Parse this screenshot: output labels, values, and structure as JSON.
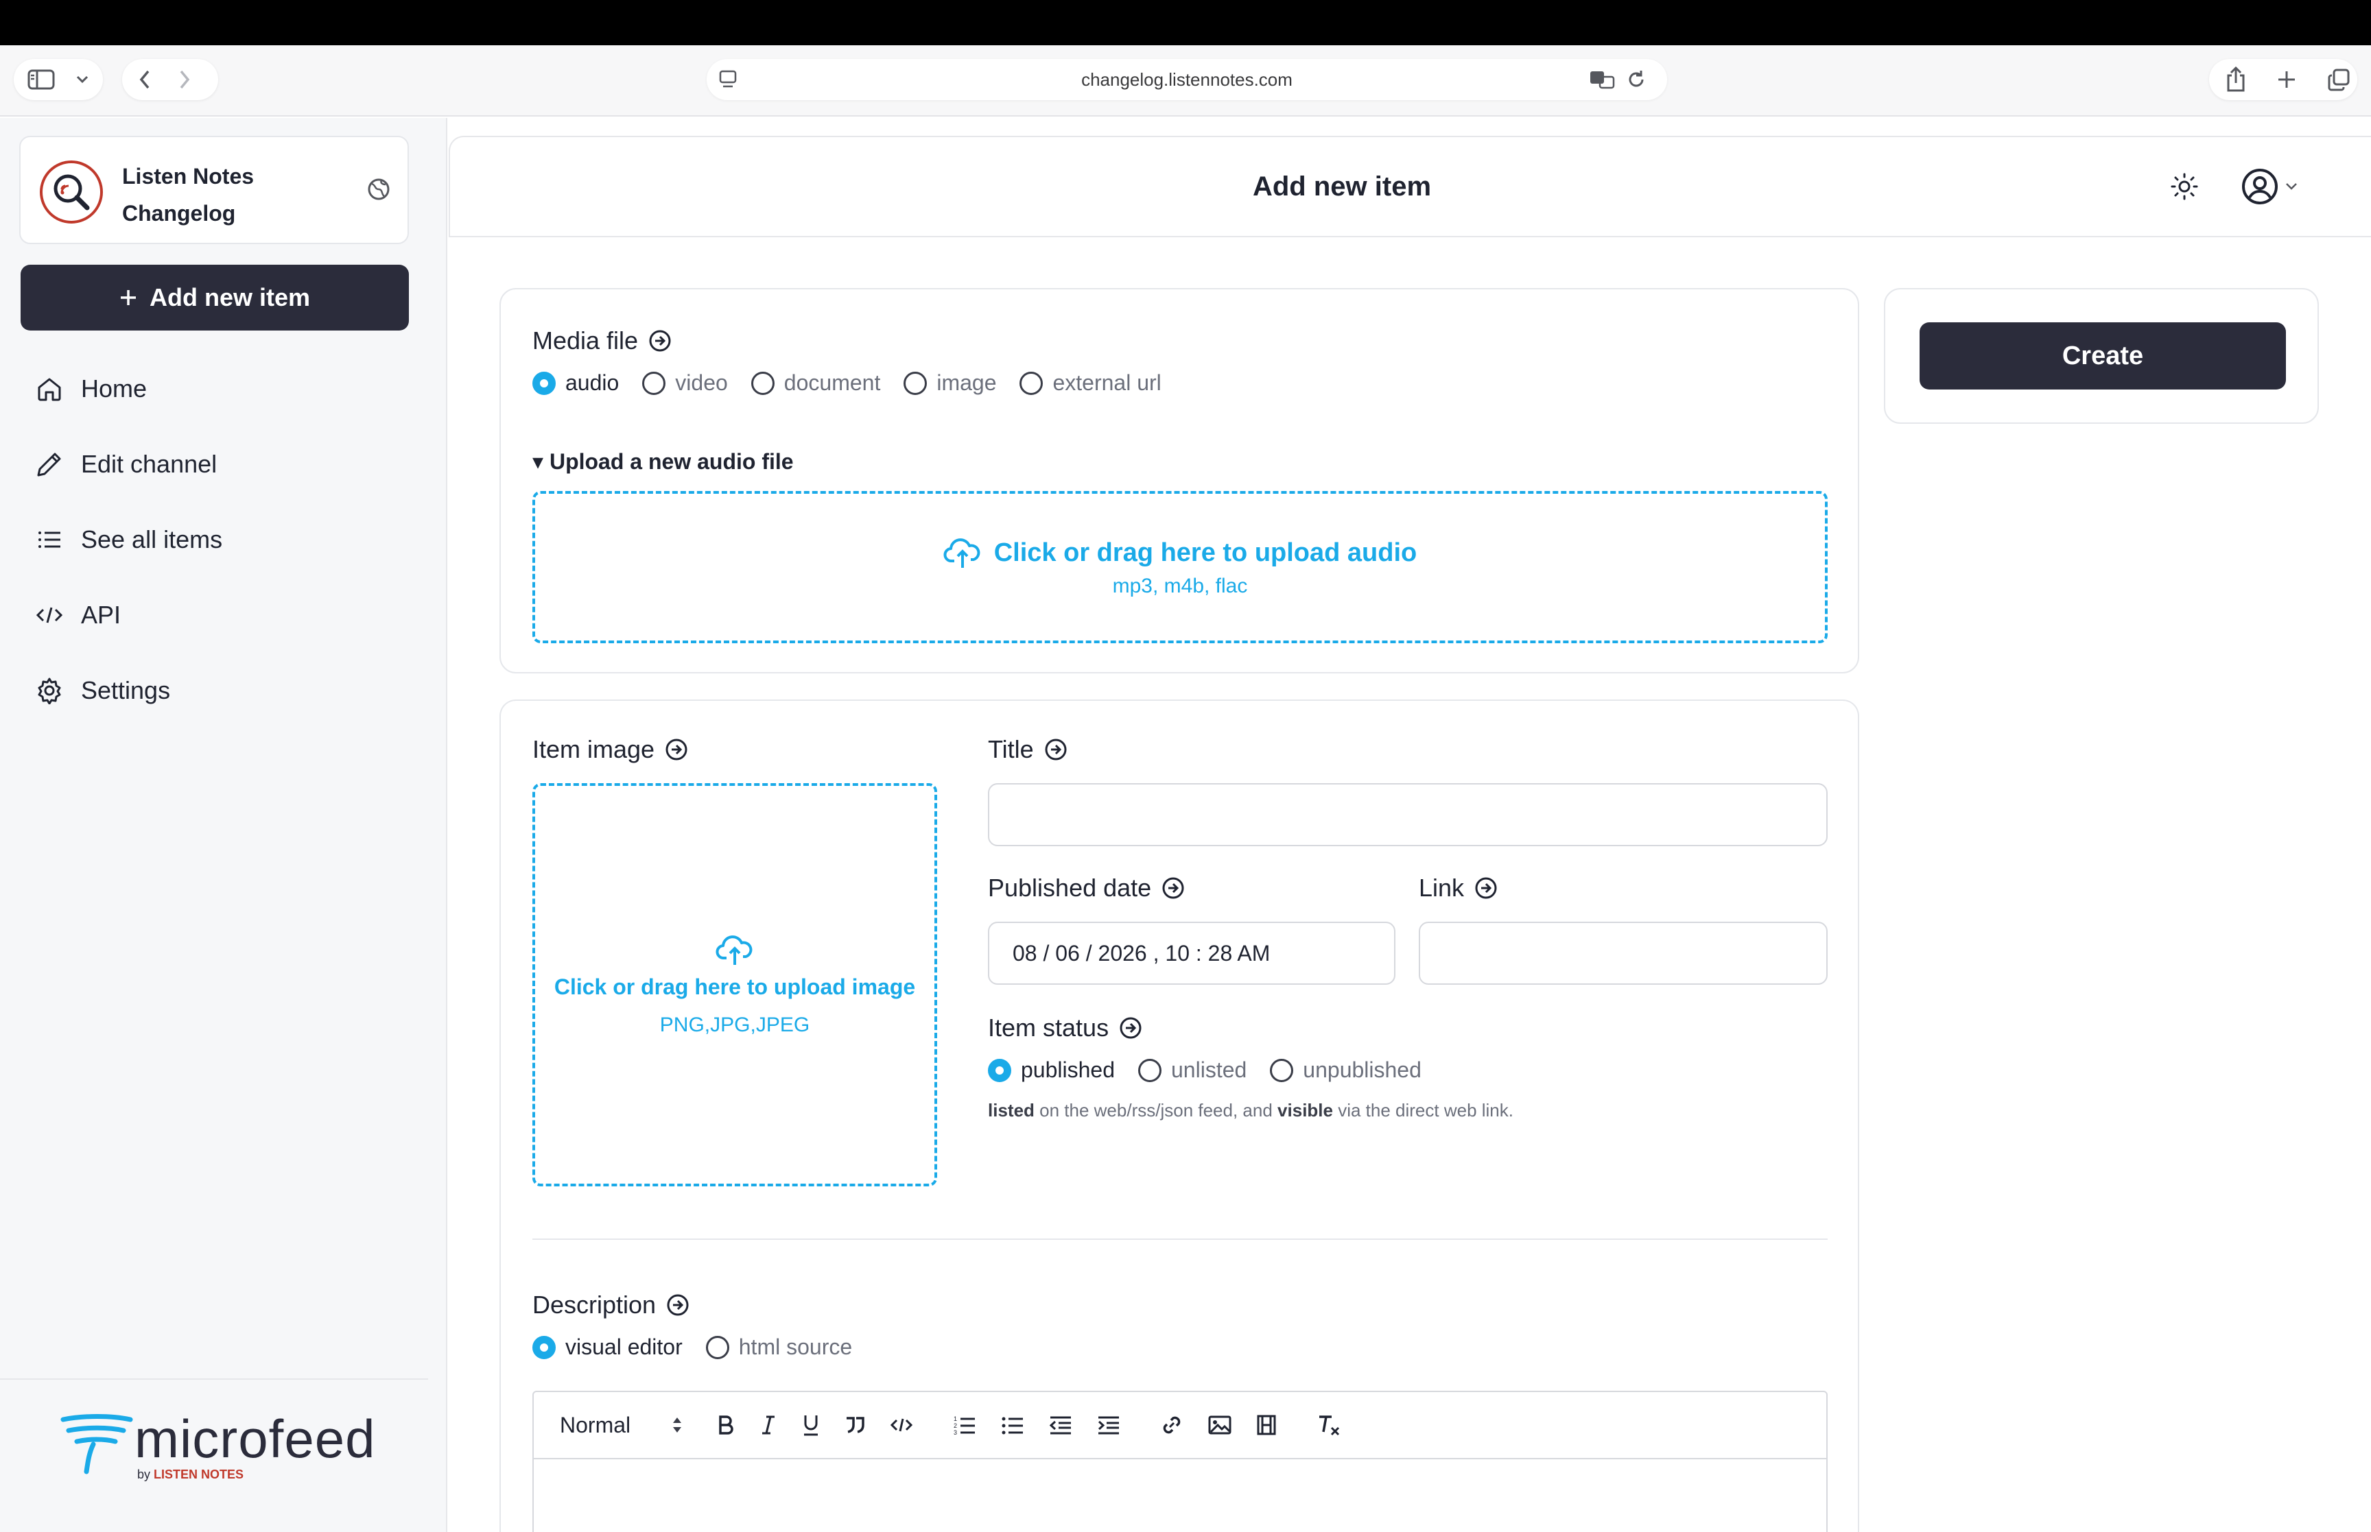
{
  "browser": {
    "url": "changelog.listennotes.com"
  },
  "sidebar": {
    "channel_name_line1": "Listen Notes",
    "channel_name_line2": "Changelog",
    "add_button_label": "Add new item",
    "items": [
      {
        "label": "Home",
        "icon": "home-icon"
      },
      {
        "label": "Edit channel",
        "icon": "pencil-icon"
      },
      {
        "label": "See all items",
        "icon": "list-icon"
      },
      {
        "label": "API",
        "icon": "code-icon"
      },
      {
        "label": "Settings",
        "icon": "gear-icon"
      }
    ],
    "brand": {
      "name": "microfeed",
      "by_prefix": "by",
      "by_brand": "LISTEN NOTES"
    }
  },
  "header": {
    "title": "Add new item"
  },
  "media": {
    "label": "Media file",
    "options": [
      "audio",
      "video",
      "document",
      "image",
      "external url"
    ],
    "selected": "audio",
    "upload_section_label": "▾ Upload a new audio file",
    "upload_cta": "Click or drag here to upload audio",
    "upload_formats": "mp3, m4b, flac"
  },
  "item": {
    "image_label": "Item image",
    "image_upload_cta": "Click or drag here to upload image",
    "image_formats": "PNG,JPG,JPEG",
    "title_label": "Title",
    "title_value": "",
    "published_date_label": "Published date",
    "published_date_value": "08 / 06 / 2026 ,  10 : 28  AM",
    "link_label": "Link",
    "link_value": "",
    "status_label": "Item status",
    "status_options": [
      "published",
      "unlisted",
      "unpublished"
    ],
    "status_selected": "published",
    "status_help_bold1": "listed",
    "status_help_mid": " on the web/rss/json feed, and ",
    "status_help_bold2": "visible",
    "status_help_end": " via the direct web link."
  },
  "description": {
    "label": "Description",
    "modes": [
      "visual editor",
      "html source"
    ],
    "selected": "visual editor",
    "format_select": "Normal"
  },
  "actions": {
    "create_label": "Create"
  },
  "colors": {
    "accent": "#1aaae8",
    "dark_button": "#2b2c3b",
    "logo_red": "#c0392b"
  }
}
